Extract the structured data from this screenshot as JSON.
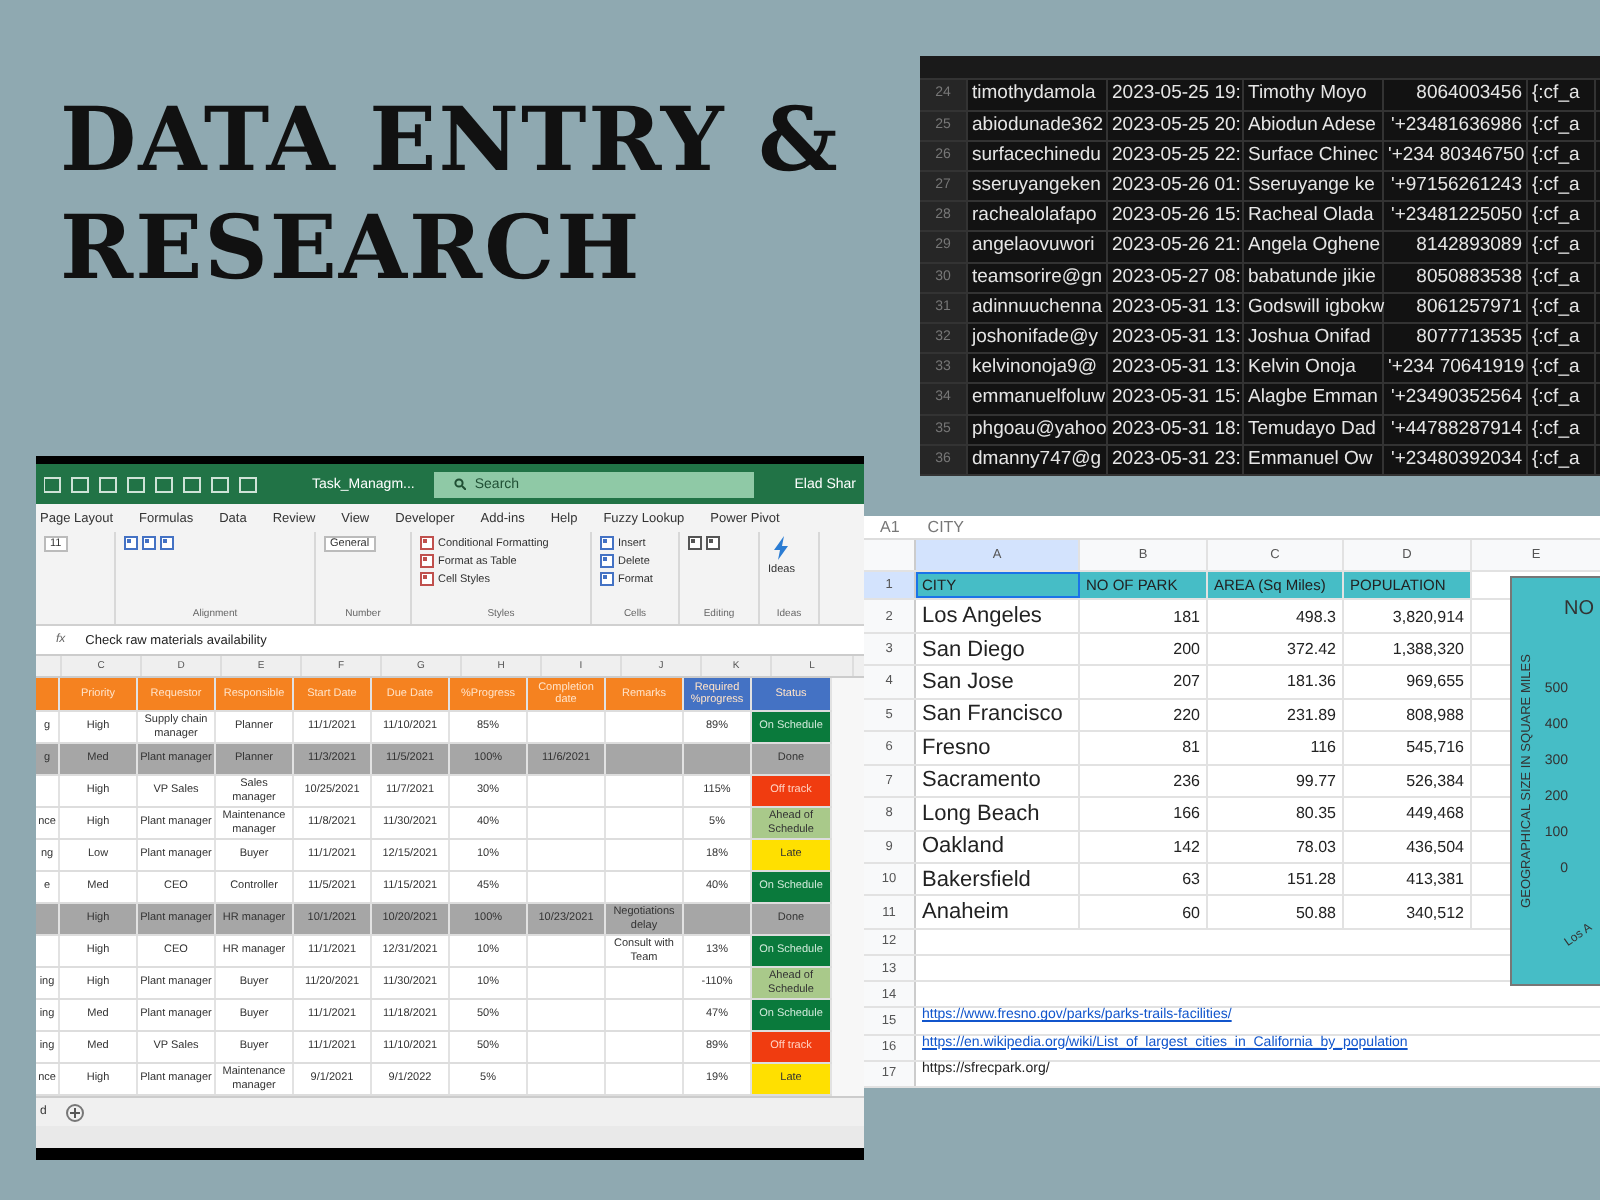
{
  "headline": {
    "lines": [
      "DATA ENTRY &",
      "RESEARCH"
    ]
  },
  "contacts_sheet": {
    "rows": [
      {
        "number": "24",
        "email": "timothydamola",
        "timestamp": "2023-05-25 19:",
        "name": "Timothy Moyo",
        "phone": "8064003456",
        "column_6": "{:cf_a"
      },
      {
        "number": "25",
        "email": "abiodunade362",
        "timestamp": "2023-05-25 20:",
        "name": "Abiodun Adese",
        "phone": "'+23481636986",
        "column_6": "{:cf_a"
      },
      {
        "number": "26",
        "email": "surfacechinedu",
        "timestamp": "2023-05-25 22:",
        "name": "Surface Chinec",
        "phone": "'+234 80346750",
        "column_6": "{:cf_a"
      },
      {
        "number": "27",
        "email": "sseruyangeken",
        "timestamp": "2023-05-26 01:",
        "name": "Sseruyange ke",
        "phone": "'+97156261243",
        "column_6": "{:cf_a"
      },
      {
        "number": "28",
        "email": "rachealolafapo",
        "timestamp": "2023-05-26 15:",
        "name": "Racheal Olada",
        "phone": "'+23481225050",
        "column_6": "{:cf_a"
      },
      {
        "number": "29",
        "email": "angelaovuwori",
        "timestamp": "2023-05-26 21:",
        "name": "Angela Oghene",
        "phone": "8142893089",
        "column_6": "{:cf_a"
      },
      {
        "number": "30",
        "email": "teamsorire@gn",
        "timestamp": "2023-05-27 08:",
        "name": "babatunde jikie",
        "phone": "8050883538",
        "column_6": "{:cf_a"
      },
      {
        "number": "31",
        "email": "adinnuuchenna",
        "timestamp": "2023-05-31 13:",
        "name": "Godswill igbokw",
        "phone": "8061257971",
        "column_6": "{:cf_a"
      },
      {
        "number": "32",
        "email": "joshonifade@y",
        "timestamp": "2023-05-31 13:",
        "name": "Joshua Onifad",
        "phone": "8077713535",
        "column_6": "{:cf_a"
      },
      {
        "number": "33",
        "email": "kelvinonoja9@",
        "timestamp": "2023-05-31 13:",
        "name": "Kelvin Onoja",
        "phone": "'+234 70641919",
        "column_6": "{:cf_a"
      },
      {
        "number": "34",
        "email": "emmanuelfoluw",
        "timestamp": "2023-05-31 15:",
        "name": "Alagbe Emman",
        "phone": "'+23490352564",
        "column_6": "{:cf_a"
      },
      {
        "number": "35",
        "email": "phgoau@yahoo",
        "timestamp": "2023-05-31 18:",
        "name": "Temudayo Dad",
        "phone": "'+44788287914",
        "column_6": "{:cf_a"
      },
      {
        "number": "36",
        "email": "dmanny747@g",
        "timestamp": "2023-05-31 23:",
        "name": "Emmanuel Ow",
        "phone": "'+23480392034",
        "column_6": "{:cf_a"
      }
    ]
  },
  "excel_window": {
    "file_name": "Task_Managm...",
    "search": {
      "placeholder": "Search"
    },
    "user": "Elad Shar",
    "ribbon_tabs": [
      "Page Layout",
      "Formulas",
      "Data",
      "Review",
      "View",
      "Developer",
      "Add-ins",
      "Help",
      "Fuzzy Lookup",
      "Power Pivot"
    ],
    "font_size": "11",
    "number_format": "General",
    "style_commands": [
      "Conditional Formatting",
      "Format as Table",
      "Cell Styles"
    ],
    "cell_commands": [
      "Insert",
      "Delete",
      "Format"
    ],
    "ideas_button": "Ideas",
    "groups": [
      "Alignment",
      "Number",
      "Styles",
      "Cells",
      "Editing",
      "Ideas"
    ],
    "fx_label": "fx",
    "formula": "Check raw materials availability",
    "column_letters": [
      "C",
      "D",
      "E",
      "F",
      "G",
      "H",
      "I",
      "J",
      "K",
      "L"
    ],
    "headers": [
      {
        "text": "Priority",
        "kind": "input"
      },
      {
        "text": "Requestor",
        "kind": "input"
      },
      {
        "text": "Responsible",
        "kind": "input"
      },
      {
        "text": "Start Date",
        "kind": "input"
      },
      {
        "text": "Due Date",
        "kind": "input"
      },
      {
        "text": "%Progress",
        "kind": "input"
      },
      {
        "text": "Completion date",
        "kind": "input"
      },
      {
        "text": "Remarks",
        "kind": "input"
      },
      {
        "text": "Required %progress",
        "kind": "computed"
      },
      {
        "text": "Status",
        "kind": "computed"
      }
    ],
    "rows": [
      {
        "lead": "g",
        "done": false,
        "priority": "High",
        "requestor": "Supply chain manager",
        "responsible": "Planner",
        "start": "11/1/2021",
        "due": "11/10/2021",
        "progress": "85%",
        "required": "89%",
        "status": "On Schedule",
        "color": "#0a7a3c"
      },
      {
        "lead": "g",
        "done": true,
        "priority": "Med",
        "requestor": "Plant manager",
        "responsible": "Planner",
        "start": "11/3/2021",
        "due": "11/5/2021",
        "progress": "100%",
        "completed": "11/6/2021",
        "status": "Done",
        "color": "#a6a6a6"
      },
      {
        "done": false,
        "priority": "High",
        "requestor": "VP Sales",
        "responsible": "Sales manager",
        "start": "10/25/2021",
        "due": "11/7/2021",
        "progress": "30%",
        "required": "115%",
        "status": "Off track",
        "color": "#f03c10"
      },
      {
        "lead": "nce",
        "done": false,
        "priority": "High",
        "requestor": "Plant manager",
        "responsible": "Maintenance manager",
        "start": "11/8/2021",
        "due": "11/30/2021",
        "progress": "40%",
        "required": "5%",
        "status": "Ahead of Schedule",
        "color": "#a9c98a"
      },
      {
        "lead": "ng",
        "done": false,
        "priority": "Low",
        "requestor": "Plant manager",
        "responsible": "Buyer",
        "start": "11/1/2021",
        "due": "12/15/2021",
        "progress": "10%",
        "required": "18%",
        "status": "Late",
        "color": "#ffe000"
      },
      {
        "lead": "e",
        "done": false,
        "priority": "Med",
        "requestor": "CEO",
        "responsible": "Controller",
        "start": "11/5/2021",
        "due": "11/15/2021",
        "progress": "45%",
        "required": "40%",
        "status": "On Schedule",
        "color": "#0a7a3c"
      },
      {
        "done": true,
        "priority": "High",
        "requestor": "Plant manager",
        "responsible": "HR manager",
        "start": "10/1/2021",
        "due": "10/20/2021",
        "progress": "100%",
        "completed": "10/23/2021",
        "remarks": "Negotiations delay",
        "status": "Done",
        "color": "#a6a6a6"
      },
      {
        "done": false,
        "priority": "High",
        "requestor": "CEO",
        "responsible": "HR manager",
        "start": "11/1/2021",
        "due": "12/31/2021",
        "progress": "10%",
        "remarks": "Consult with Team",
        "required": "13%",
        "status": "On Schedule",
        "color": "#0a7a3c"
      },
      {
        "lead": "ing",
        "done": false,
        "priority": "High",
        "requestor": "Plant manager",
        "responsible": "Buyer",
        "start": "11/20/2021",
        "due": "11/30/2021",
        "progress": "10%",
        "required": "-110%",
        "status": "Ahead of Schedule",
        "color": "#a9c98a"
      },
      {
        "lead": "ing",
        "done": false,
        "priority": "Med",
        "requestor": "Plant manager",
        "responsible": "Buyer",
        "start": "11/1/2021",
        "due": "11/18/2021",
        "progress": "50%",
        "required": "47%",
        "status": "On Schedule",
        "color": "#0a7a3c"
      },
      {
        "lead": "ing",
        "done": false,
        "priority": "Med",
        "requestor": "VP Sales",
        "responsible": "Buyer",
        "start": "11/1/2021",
        "due": "11/10/2021",
        "progress": "50%",
        "required": "89%",
        "status": "Off track",
        "color": "#f03c10"
      },
      {
        "lead": "nce",
        "done": false,
        "priority": "High",
        "requestor": "Plant manager",
        "responsible": "Maintenance manager",
        "start": "9/1/2021",
        "due": "9/1/2022",
        "progress": "5%",
        "required": "19%",
        "status": "Late",
        "color": "#ffe000"
      }
    ],
    "sheet_tab": "d"
  },
  "cities_sheet": {
    "name_box": "A1",
    "formula": "CITY",
    "column_letters": [
      {
        "text": "A",
        "selected": true
      },
      {
        "text": "B",
        "selected": false
      },
      {
        "text": "C",
        "selected": false
      },
      {
        "text": "D",
        "selected": false
      },
      {
        "text": "E",
        "selected": false
      }
    ],
    "header": {
      "number": "1",
      "cells": [
        {
          "text": "CITY",
          "selected": true
        },
        {
          "text": "NO OF PARK",
          "selected": false
        },
        {
          "text": "AREA (Sq Miles)",
          "selected": false
        },
        {
          "text": "POPULATION",
          "selected": false
        }
      ]
    },
    "rows": [
      {
        "number": "2",
        "city": "Los Angeles",
        "parks": "181",
        "area": "498.3",
        "population": "3,820,914"
      },
      {
        "number": "3",
        "city": "San Diego",
        "parks": "200",
        "area": "372.42",
        "population": "1,388,320"
      },
      {
        "number": "4",
        "city": "San Jose",
        "parks": "207",
        "area": "181.36",
        "population": "969,655"
      },
      {
        "number": "5",
        "city": "San Francisco",
        "parks": "220",
        "area": "231.89",
        "population": "808,988"
      },
      {
        "number": "6",
        "city": "Fresno",
        "parks": "81",
        "area": "116",
        "population": "545,716"
      },
      {
        "number": "7",
        "city": "Sacramento",
        "parks": "236",
        "area": "99.77",
        "population": "526,384"
      },
      {
        "number": "8",
        "city": "Long Beach",
        "parks": "166",
        "area": "80.35",
        "population": "449,468"
      },
      {
        "number": "9",
        "city": "Oakland",
        "parks": "142",
        "area": "78.03",
        "population": "436,504"
      },
      {
        "number": "10",
        "city": "Bakersfield",
        "parks": "63",
        "area": "151.28",
        "population": "413,381"
      },
      {
        "number": "11",
        "city": "Anaheim",
        "parks": "60",
        "area": "50.88",
        "population": "340,512"
      }
    ],
    "empty_rows": [
      "12",
      "13",
      "14"
    ],
    "source_rows": [
      {
        "number": "15",
        "kind": "link",
        "text": "https://www.fresno.gov/parks/parks-trails-facilities/"
      },
      {
        "number": "16",
        "kind": "link",
        "text": "https://en.wikipedia.org/wiki/List_of_largest_cities_in_California_by_population"
      },
      {
        "number": "17",
        "kind": "text",
        "text": "https://sfrecpark.org/"
      }
    ],
    "chart": {
      "title": "NO",
      "axis_label": "GEOGRAPHICAL SIZE IN SQUARE MILES",
      "ticks": [
        "500",
        "400",
        "300",
        "200",
        "100",
        "0"
      ],
      "category": "Los A"
    }
  }
}
